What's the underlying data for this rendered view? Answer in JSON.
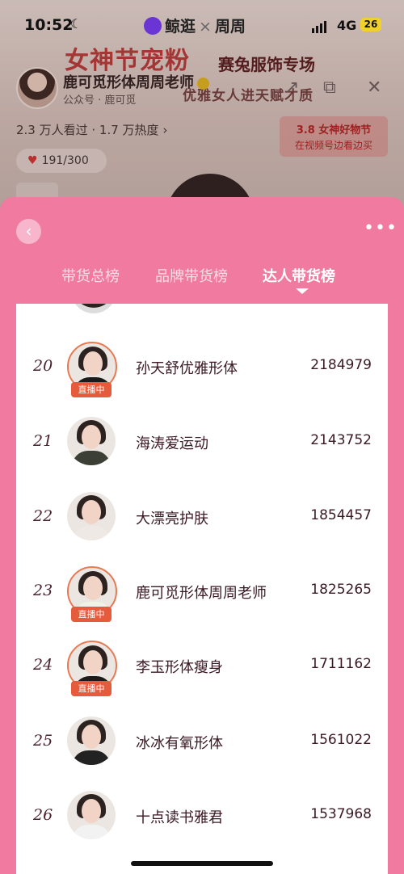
{
  "status_bar": {
    "time": "10:52",
    "network": "4G",
    "battery": "26"
  },
  "header": {
    "brand": "鲸逛",
    "partner": "周周",
    "banner_title": "女神节宠粉",
    "banner_subtitle": "赛兔服饰专场",
    "banner_tagline": "优雅女人进天赋才质",
    "host_name": "鹿可觅形体周周老师",
    "host_sub": "公众号 · 鹿可觅",
    "stats": "2.3 万人看过 · 1.7 万热度 ›",
    "likes": "191/300",
    "promo_line1": "3.8 女神好物节",
    "promo_line2": "在视频号边看边买"
  },
  "tabs": [
    {
      "label": "带货总榜"
    },
    {
      "label": "品牌带货榜"
    },
    {
      "label": "达人带货榜"
    }
  ],
  "live_badge": "直播中",
  "rankings": [
    {
      "rank": "20",
      "name": "孙天舒优雅形体",
      "score": "2184979",
      "live": true
    },
    {
      "rank": "21",
      "name": "海涛爱运动",
      "score": "2143752",
      "live": false
    },
    {
      "rank": "22",
      "name": "大漂亮护肤",
      "score": "1854457",
      "live": false
    },
    {
      "rank": "23",
      "name": "鹿可觅形体周周老师",
      "score": "1825265",
      "live": true
    },
    {
      "rank": "24",
      "name": "李玉形体瘦身",
      "score": "1711162",
      "live": true
    },
    {
      "rank": "25",
      "name": "冰冰有氧形体",
      "score": "1561022",
      "live": false
    },
    {
      "rank": "26",
      "name": "十点读书雅君",
      "score": "1537968",
      "live": false
    }
  ],
  "colors": {
    "sheet": "#f07aa0",
    "live_tag": "#e55b3c",
    "text": "#3a1824"
  }
}
